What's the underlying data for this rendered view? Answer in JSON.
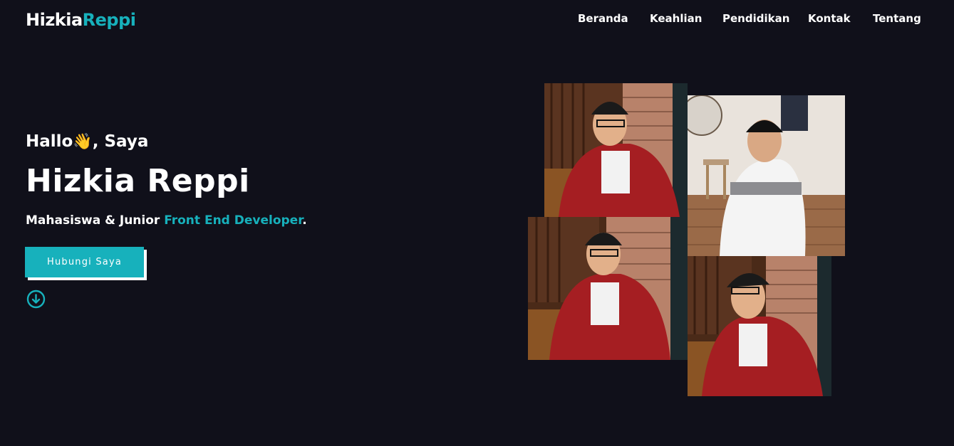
{
  "brand": {
    "first": "Hizkia",
    "second": "Reppi",
    "accent_color": "#17b1bc"
  },
  "nav": {
    "items": [
      {
        "label": "Beranda"
      },
      {
        "label": "Keahlian"
      },
      {
        "label": "Pendidikan"
      },
      {
        "label": "Kontak"
      },
      {
        "label": "Tentang"
      }
    ]
  },
  "hero": {
    "greeting_prefix": "Hallo",
    "greeting_emoji": "👋",
    "greeting_suffix": ", Saya",
    "name": "Hizkia Reppi",
    "role_prefix": "Mahasiswa & Junior ",
    "role_highlight": "Front End Developer",
    "role_suffix": ".",
    "cta_label": "Hubungi Saya",
    "scroll_icon": "arrow-down-circle-icon"
  },
  "colors": {
    "background": "#10101a",
    "accent": "#17b1bc",
    "text": "#ffffff"
  }
}
